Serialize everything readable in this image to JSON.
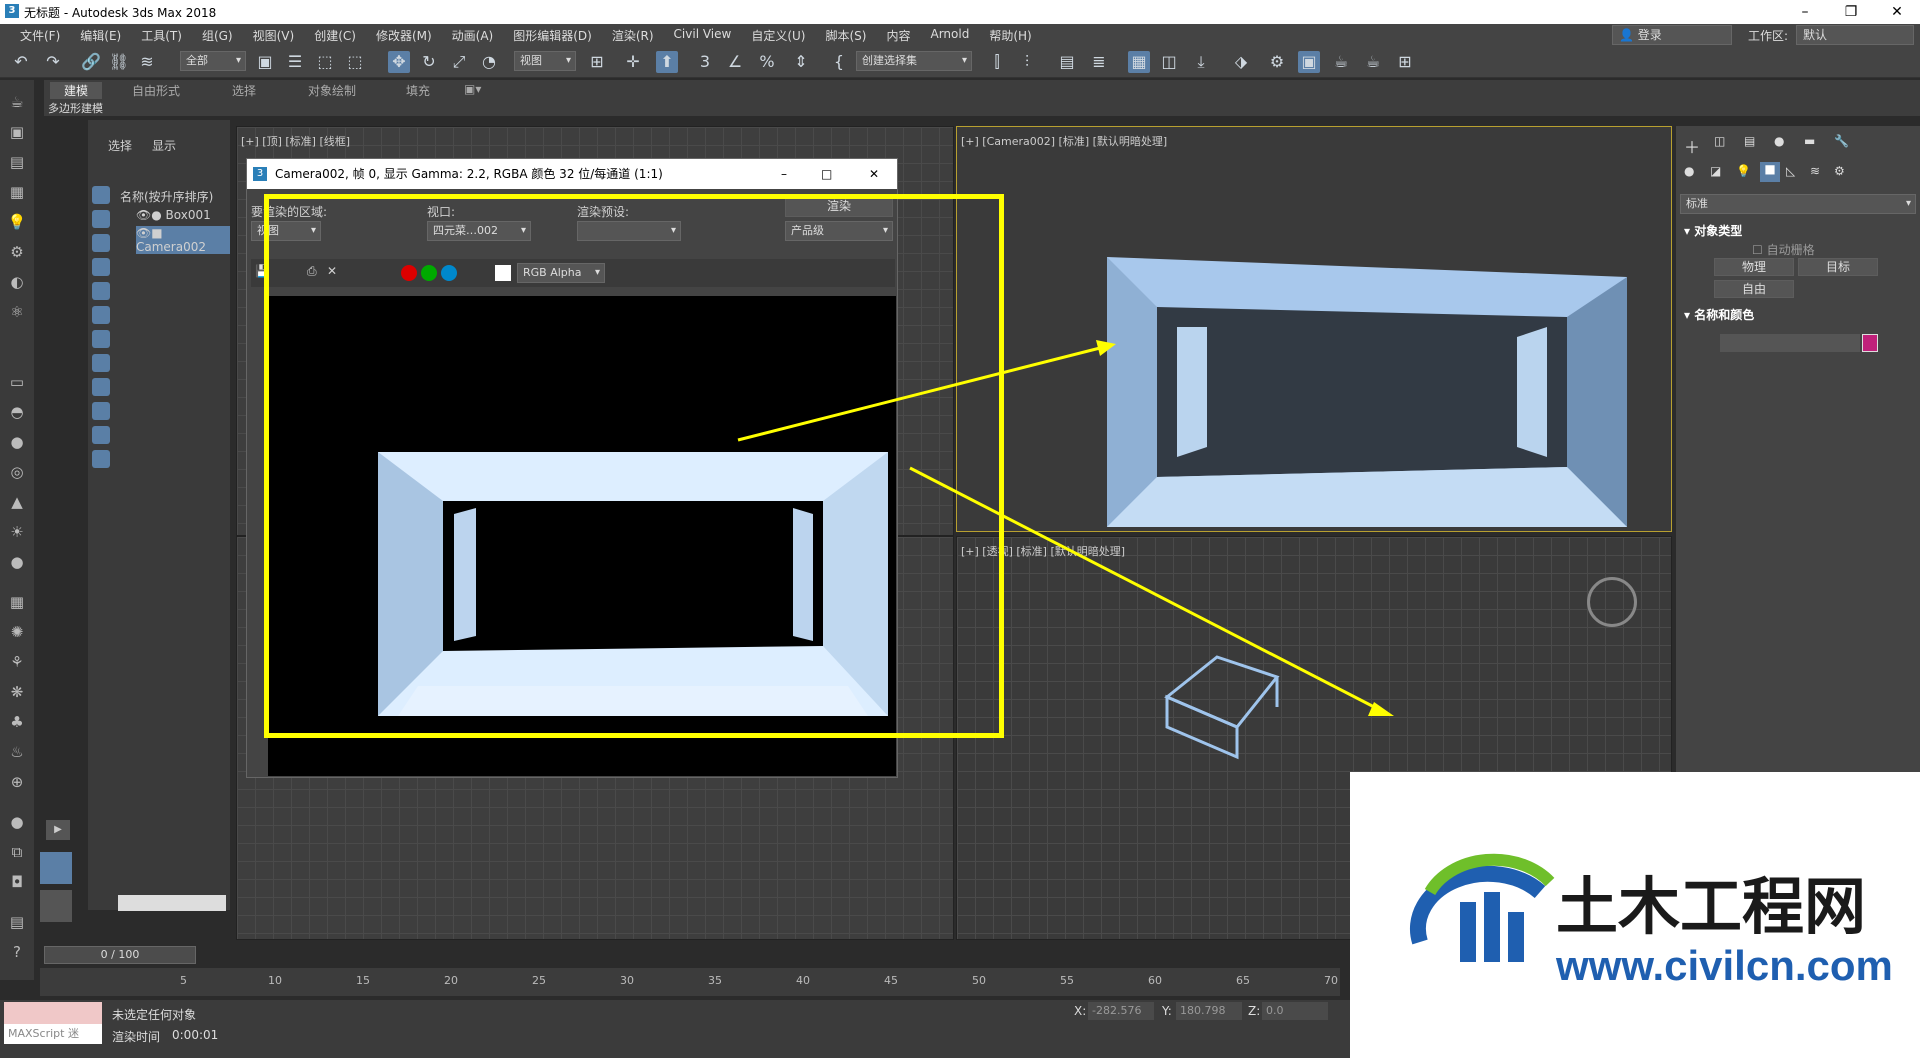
{
  "window": {
    "title": "无标题 - Autodesk 3ds Max 2018",
    "icon": "3"
  },
  "menu": [
    "文件(F)",
    "编辑(E)",
    "工具(T)",
    "组(G)",
    "视图(V)",
    "创建(C)",
    "修改器(M)",
    "动画(A)",
    "图形编辑器(D)",
    "渲染(R)",
    "Civil View",
    "自定义(U)",
    "脚本(S)",
    "内容",
    "Arnold",
    "帮助(H)"
  ],
  "login": "登录",
  "workspace": {
    "label": "工作区:",
    "value": "默认"
  },
  "toolbar": {
    "filter": "全部",
    "refcoord": "视图",
    "selset": "创建选择集"
  },
  "ribbon": {
    "tabs": [
      "建模",
      "自由形式",
      "选择",
      "对象绘制",
      "填充"
    ],
    "sub": "多边形建模"
  },
  "scene_explorer": {
    "tabs": [
      "选择",
      "显示"
    ],
    "header": "名称(按升序排序)",
    "items": [
      "Box001",
      "Camera002"
    ]
  },
  "viewports": {
    "top_left": "[+] [顶] [标准] [线框]",
    "top_right": "[+] [Camera002] [标准] [默认明暗处理]",
    "bottom_right": "[+] [透视] [标准] [默认明暗处理]"
  },
  "render_window": {
    "title": "Camera002, 帧 0, 显示 Gamma: 2.2, RGBA 颜色 32 位/每通道 (1:1)",
    "area_label": "要渲染的区域:",
    "area_value": "视图",
    "viewport_label": "视口:",
    "viewport_value": "四元菜…002",
    "preset_label": "渲染预设:",
    "preset_value": "",
    "render_button": "渲染",
    "quality": "产品级",
    "channel": "RGB Alpha"
  },
  "right_panel": {
    "dropdown": "标准",
    "object_type": "对象类型",
    "autogrid": "自动栅格",
    "buttons": [
      "物理",
      "目标",
      "自由"
    ],
    "name_color": "名称和颜色",
    "swatch": "#c0207a"
  },
  "timeline": {
    "frame": "0 / 100",
    "ticks": [
      "5",
      "10",
      "15",
      "20",
      "25",
      "30",
      "35",
      "40",
      "45",
      "50",
      "55",
      "60",
      "65",
      "70"
    ]
  },
  "status": {
    "line1": "未选定任何对象",
    "line2_label": "渲染时间",
    "line2_value": "0:00:01",
    "maxscript": "MAXScript 迷",
    "x_label": "X:",
    "x_value": "-282.576",
    "y_label": "Y:",
    "y_value": "180.798",
    "z_label": "Z:",
    "z_value": "0.0"
  },
  "watermark": {
    "cn": "土木工程网",
    "url": "www.civilcn.com"
  },
  "colors": {
    "accent": "#5b7fa6",
    "highlight": "#ffff00",
    "object": "#a8c8ec"
  }
}
